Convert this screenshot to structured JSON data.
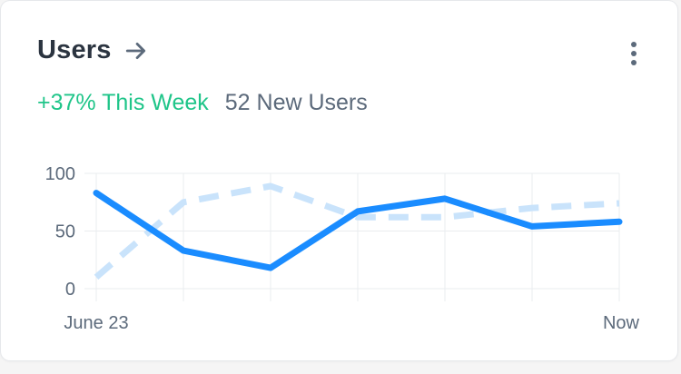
{
  "header": {
    "title": "Users",
    "arrow_icon": "arrow-right-icon",
    "menu_icon": "kebab-menu-icon"
  },
  "stats": {
    "growth": "+37% This Week",
    "new_users": "52 New Users"
  },
  "colors": {
    "primary_line": "#1a8cff",
    "secondary_line": "#c9e3fb",
    "growth": "#1fc589",
    "muted_text": "#5c6a7b",
    "grid": "#eaecef"
  },
  "chart_data": {
    "type": "line",
    "x": [
      "June 23",
      "",
      "",
      "",
      "",
      "",
      "Now"
    ],
    "x_tick_labels": [
      {
        "index": 0,
        "label": "June 23"
      },
      {
        "index": 6,
        "label": "Now"
      }
    ],
    "ylim": [
      0,
      100
    ],
    "yticks": [
      0,
      50,
      100
    ],
    "grid": true,
    "series": [
      {
        "style": "solid",
        "values": [
          83,
          33,
          18,
          67,
          78,
          54,
          58
        ]
      },
      {
        "style": "dashed",
        "values": [
          10,
          75,
          89,
          62,
          62,
          70,
          74
        ]
      }
    ]
  }
}
